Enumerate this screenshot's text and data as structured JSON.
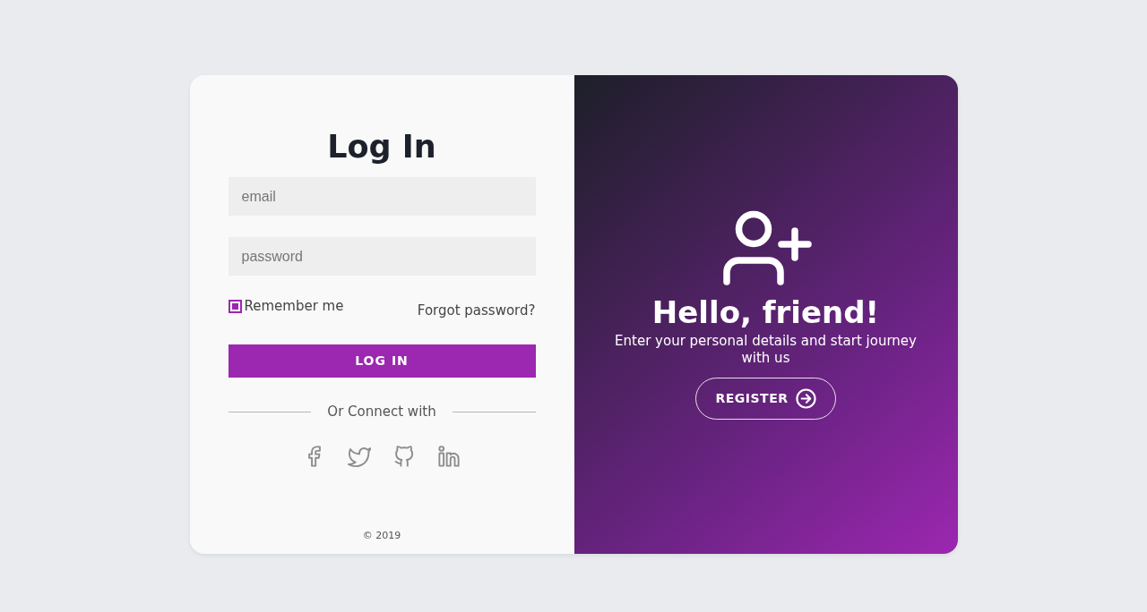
{
  "login": {
    "title": "Log In",
    "fields": [
      {
        "placeholder": "email"
      },
      {
        "placeholder": "password"
      }
    ],
    "remember": {
      "label": "Remember me",
      "checked": true
    },
    "forgot_link": "Forgot password?",
    "submit_button": "LOG IN",
    "divider_text": "Or Connect with",
    "footer": "© 2019"
  },
  "register": {
    "heading": "Hello, friend!",
    "text": "Enter your personal details and start journey with us",
    "button": "REGISTER"
  }
}
